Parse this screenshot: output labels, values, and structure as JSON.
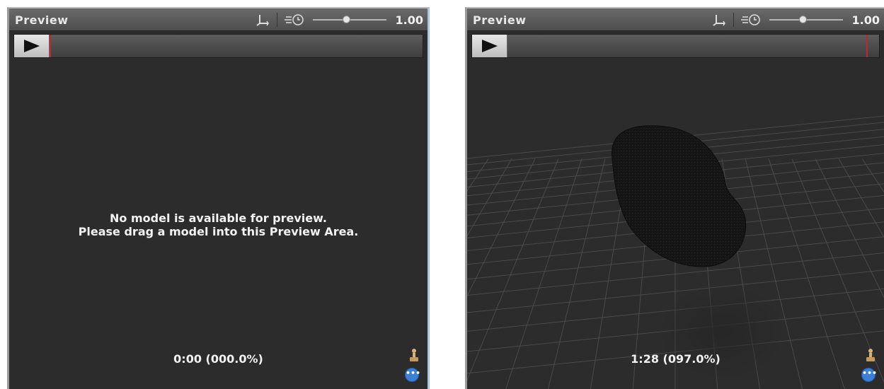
{
  "left_panel": {
    "title": "Preview",
    "speed_value": "1.00",
    "speed_fraction": 0.45,
    "playhead_fraction": 0.0,
    "message_line1": "No model is available for preview.",
    "message_line2": "Please drag a model into this Preview Area.",
    "time_readout": "0:00 (000.0%)",
    "icons": {
      "pivot": "pivot-axis-icon",
      "speed": "playback-speed-icon",
      "avatar": "avatar-figure-icon",
      "more": "more-options-icon"
    }
  },
  "right_panel": {
    "title": "Preview",
    "speed_value": "1.00",
    "speed_fraction": 0.45,
    "playhead_fraction": 0.97,
    "time_readout": "1:28 (097.0%)",
    "icons": {
      "pivot": "pivot-axis-icon",
      "speed": "playback-speed-icon",
      "avatar": "avatar-figure-icon",
      "more": "more-options-icon"
    }
  },
  "colors": {
    "panel_background": "#2c2c2c",
    "grid_line": "#4a4a4a",
    "playhead": "#c0262b",
    "model": "#141414"
  }
}
